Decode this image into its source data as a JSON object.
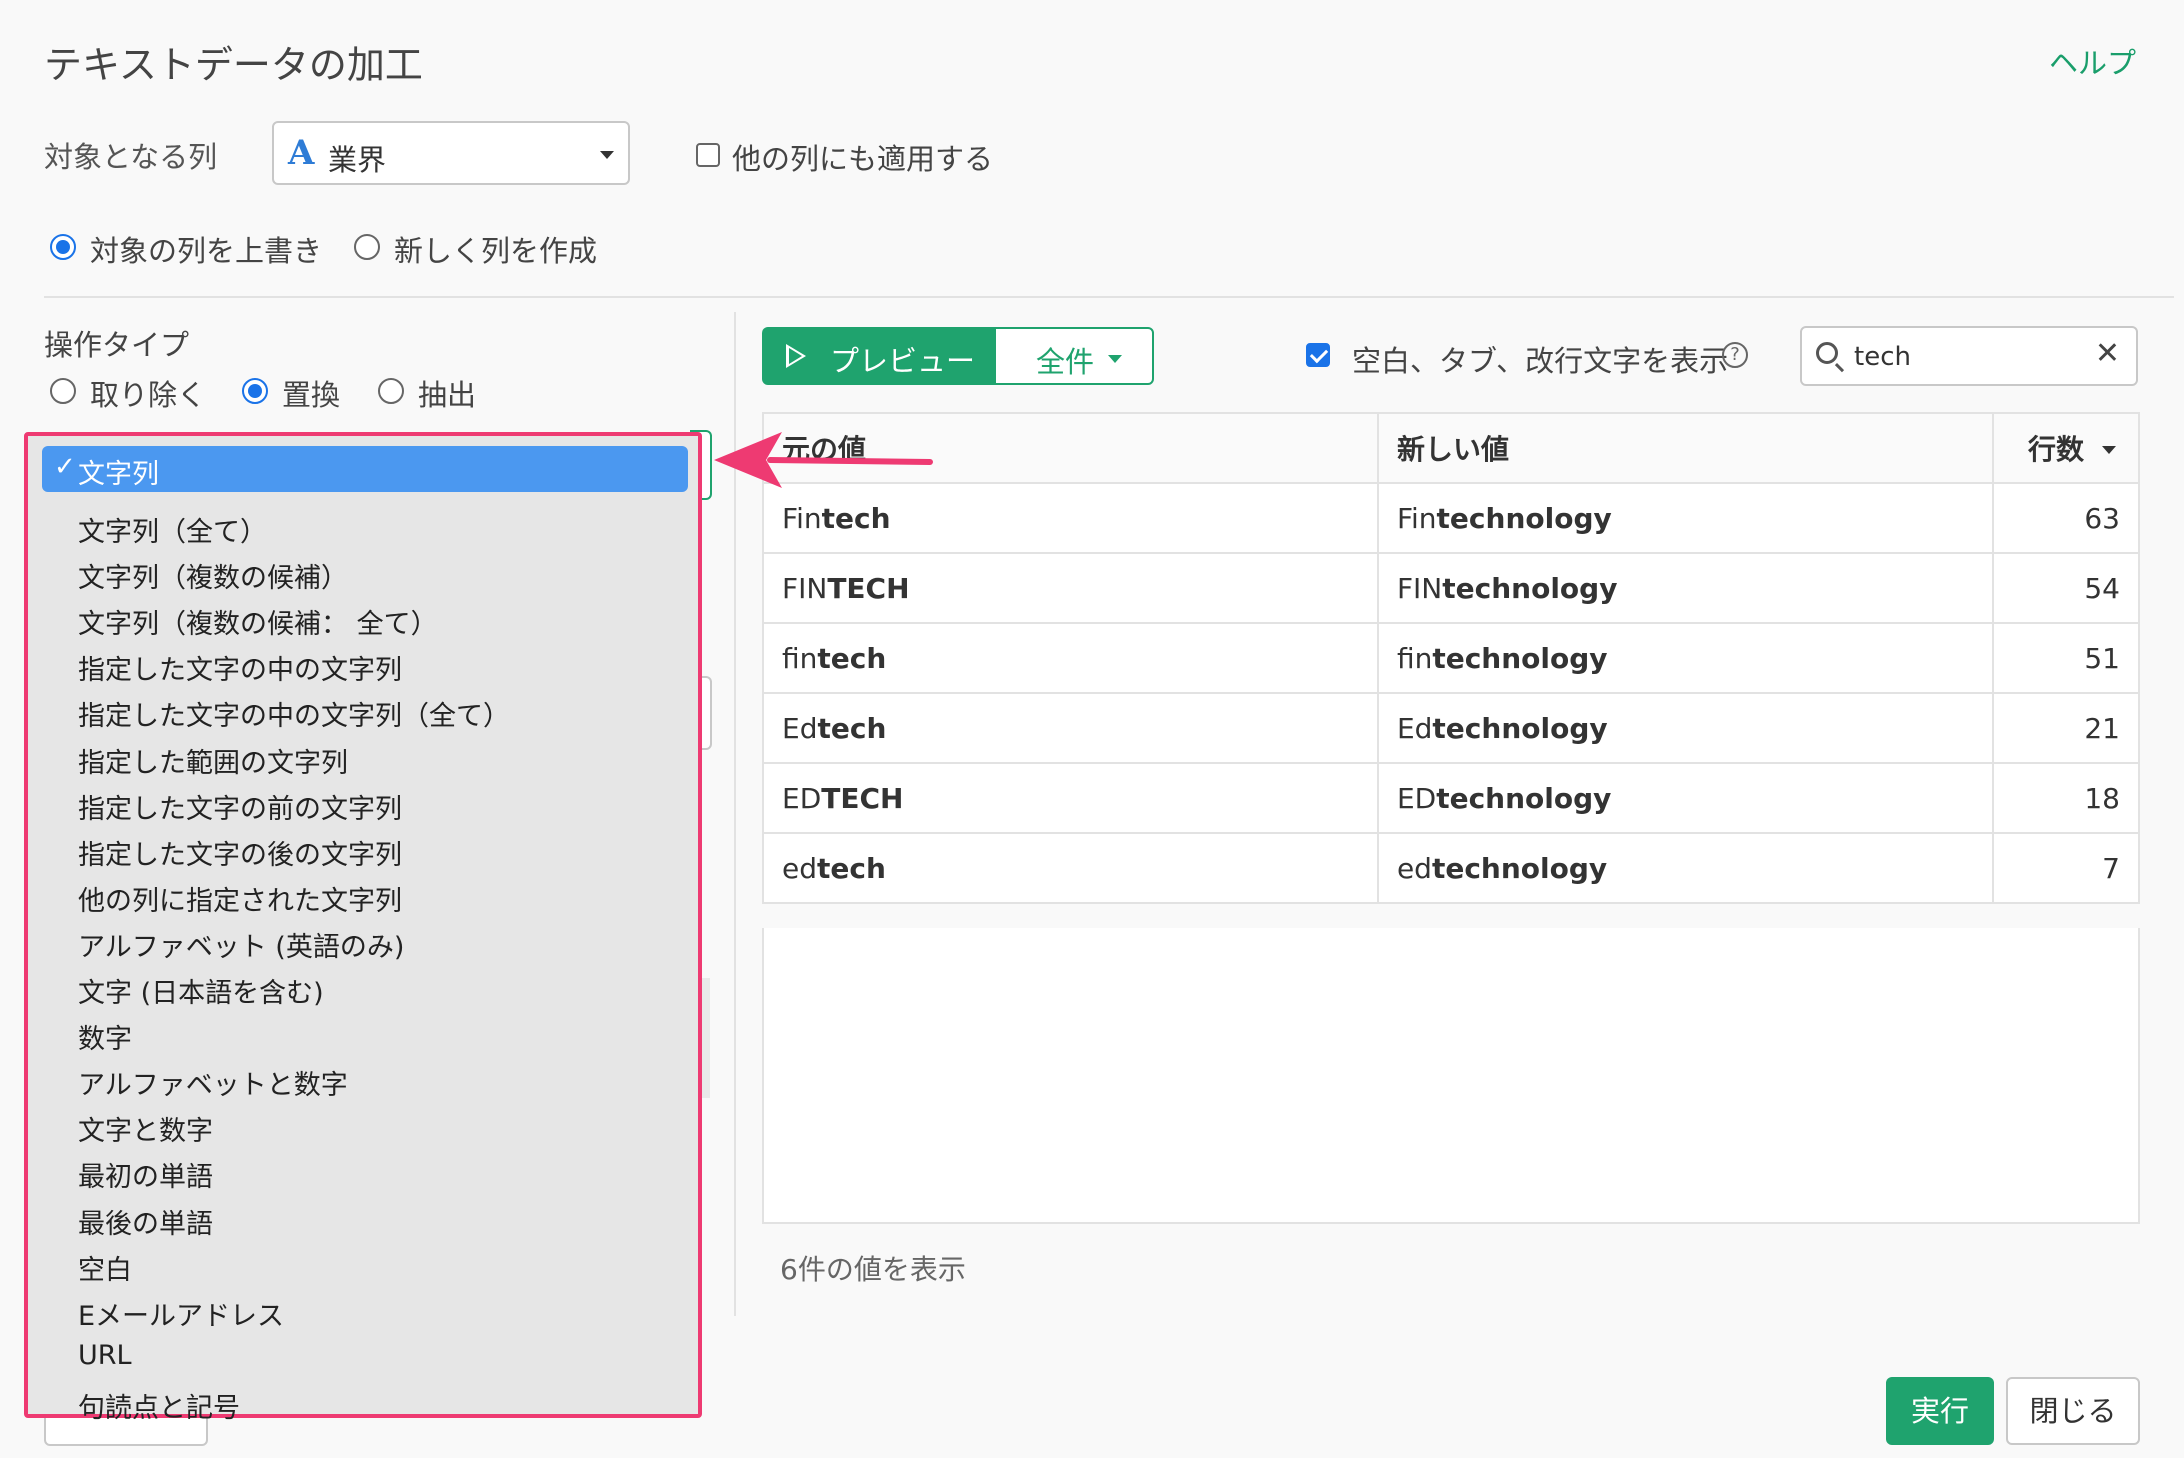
{
  "header": {
    "title": "テキストデータの加工",
    "help": "ヘルプ"
  },
  "target": {
    "label": "対象となる列",
    "column_type_icon": "A",
    "column": "業界",
    "apply_others": "他の列にも適用する"
  },
  "output_mode": {
    "overwrite": "対象の列を上書き",
    "new_column": "新しく列を作成",
    "selected": "overwrite"
  },
  "operation": {
    "label": "操作タイプ",
    "remove": "取り除く",
    "replace": "置換",
    "extract": "抽出",
    "selected": "replace"
  },
  "dropdown": {
    "selected": "文字列",
    "items": [
      "文字列（全て）",
      "文字列（複数の候補）",
      "文字列（複数の候補： 全て）",
      "指定した文字の中の文字列",
      "指定した文字の中の文字列（全て）",
      "指定した範囲の文字列",
      "指定した文字の前の文字列",
      "指定した文字の後の文字列",
      "他の列に指定された文字列",
      "アルファベット (英語のみ)",
      "文字 (日本語を含む)",
      "数字",
      "アルファベットと数字",
      "文字と数字",
      "最初の単語",
      "最後の単語",
      "空白",
      "Eメールアドレス",
      "URL",
      "句読点と記号"
    ]
  },
  "preview": {
    "preview_button": "プレビュー",
    "all_button": "全件",
    "show_whitespace": "空白、タブ、改行文字を表示",
    "search_value": "tech"
  },
  "table": {
    "headers": {
      "original": "元の値",
      "new": "新しい値",
      "count": "行数"
    },
    "rows": [
      {
        "orig_prefix": "Fin",
        "orig_match": "tech",
        "new_prefix": "Fin",
        "new_match": "technology",
        "count": "63"
      },
      {
        "orig_prefix": "FIN",
        "orig_match": "TECH",
        "new_prefix": "FIN",
        "new_match": "technology",
        "count": "54"
      },
      {
        "orig_prefix": "fin",
        "orig_match": "tech",
        "new_prefix": "fin",
        "new_match": "technology",
        "count": "51"
      },
      {
        "orig_prefix": "Ed",
        "orig_match": "tech",
        "new_prefix": "Ed",
        "new_match": "technology",
        "count": "21"
      },
      {
        "orig_prefix": "ED",
        "orig_match": "TECH",
        "new_prefix": "ED",
        "new_match": "technology",
        "count": "18"
      },
      {
        "orig_prefix": "ed",
        "orig_match": "tech",
        "new_prefix": "ed",
        "new_match": "technology",
        "count": "7"
      }
    ],
    "footer": "6件の値を表示"
  },
  "actions": {
    "run": "実行",
    "close": "閉じる"
  },
  "colors": {
    "accent_green": "#1fa36e",
    "highlight_blue": "#4b98f0",
    "annotation_pink": "#ee3a72"
  }
}
